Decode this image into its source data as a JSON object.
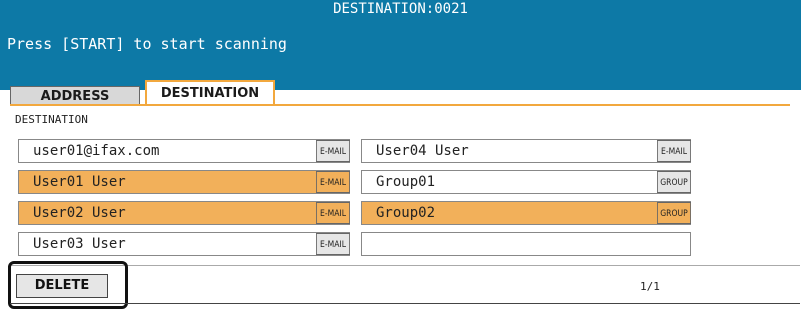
{
  "header": {
    "destination_title": "DESTINATION:0021",
    "message": "Press [START] to start scanning"
  },
  "tabs": [
    {
      "label": "ADDRESS",
      "active": false
    },
    {
      "label": "DESTINATION",
      "active": true
    }
  ],
  "section_label": "DESTINATION",
  "left_column": [
    {
      "name": "user01@ifax.com",
      "type": "E-MAIL",
      "selected": false
    },
    {
      "name": "User01 User",
      "type": "E-MAIL",
      "selected": true
    },
    {
      "name": "User02 User",
      "type": "E-MAIL",
      "selected": true
    },
    {
      "name": "User03 User",
      "type": "E-MAIL",
      "selected": false
    }
  ],
  "right_column": [
    {
      "name": "User04 User",
      "type": "E-MAIL",
      "selected": false
    },
    {
      "name": "Group01",
      "type": "GROUP",
      "selected": false
    },
    {
      "name": "Group02",
      "type": "GROUP",
      "selected": true
    },
    {
      "name": "",
      "type": "",
      "selected": false
    }
  ],
  "footer": {
    "delete_label": "DELETE",
    "page_indicator": "1/1"
  },
  "colors": {
    "header_bg": "#0d79a6",
    "selection": "#f2b05a",
    "tab_accent": "#f2a83e"
  }
}
